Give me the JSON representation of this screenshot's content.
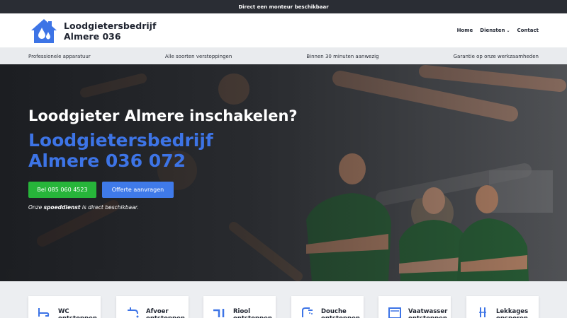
{
  "topbar": {
    "text": "Direct een monteur beschikbaar"
  },
  "logo": {
    "line1": "Loodgietersbedrijf",
    "line2": "Almere 036"
  },
  "nav": {
    "home": "Home",
    "diensten": "Diensten",
    "contact": "Contact"
  },
  "usp": [
    "Professionele apparatuur",
    "Alle soorten verstoppingen",
    "Binnen 30 minuten aanwezig",
    "Garantie op onze werkzaamheden"
  ],
  "hero": {
    "title": "Loodgieter Almere inschakelen?",
    "subtitle": "Loodgietersbedrijf Almere 036 072",
    "call_button": "Bel 085 060 4523",
    "quote_button": "Offerte aanvragen",
    "note_pre": "Onze ",
    "note_bold": "spoeddienst",
    "note_post": " is direct beschikbaar."
  },
  "services": [
    {
      "title": "WC",
      "sub": "ontstoppen"
    },
    {
      "title": "Afvoer",
      "sub": "ontstoppen"
    },
    {
      "title": "Riool",
      "sub": "ontstoppen"
    },
    {
      "title": "Douche",
      "sub": "ontstoppen"
    },
    {
      "title": "Vaatwasser",
      "sub": "ontstoppen"
    },
    {
      "title": "Lekkages",
      "sub": "opsporen"
    }
  ],
  "colors": {
    "brand_blue": "#3d74e6",
    "call_green": "#27b53a",
    "topbar": "#2a2d34"
  }
}
